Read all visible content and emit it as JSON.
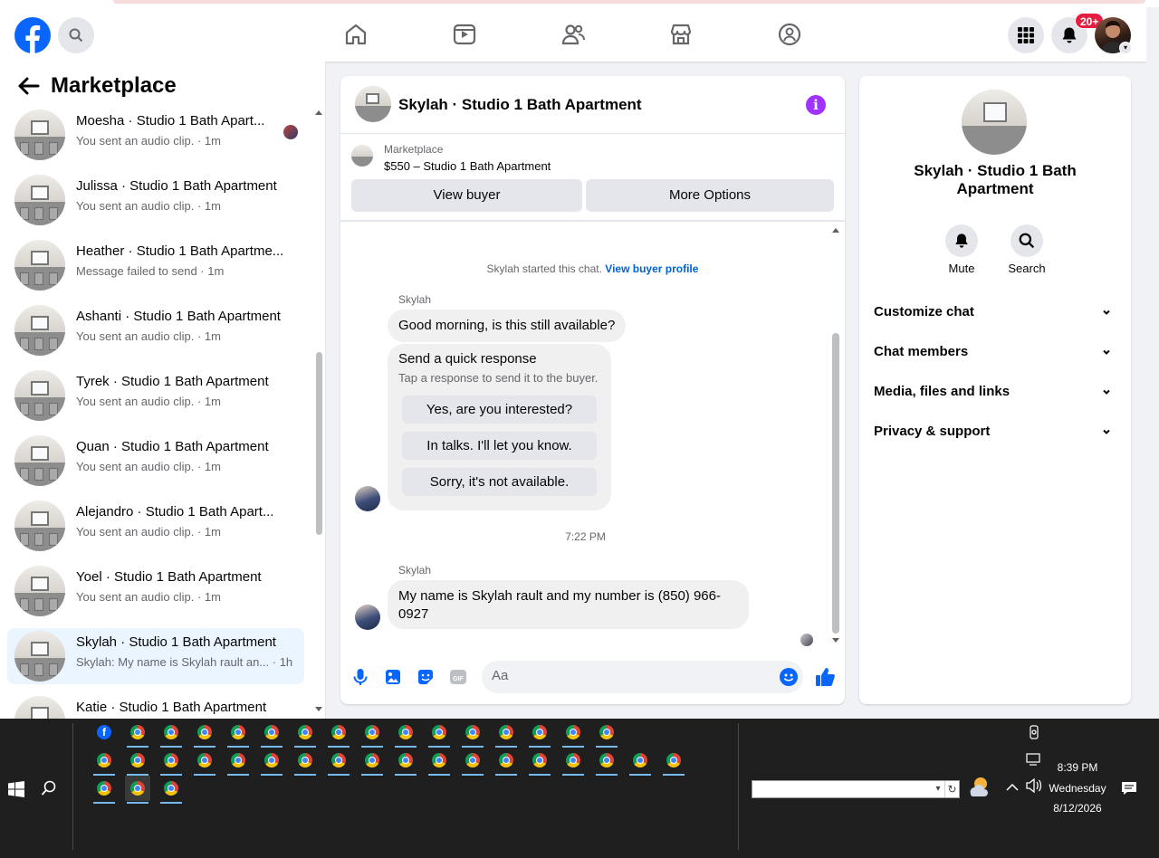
{
  "topnav": {
    "icons": [
      "facebook-logo",
      "search-icon",
      "home-icon",
      "video-icon",
      "friends-icon",
      "marketplace-icon",
      "groups-icon",
      "menu-grid-icon",
      "notifications-bell-icon"
    ],
    "notifications_badge": "20+"
  },
  "sidebar": {
    "title": "Marketplace",
    "conversations": [
      {
        "name": "Moesha · Studio 1 Bath Apart...",
        "sub": "You sent an audio clip. · 1m",
        "active": false
      },
      {
        "name": "Julissa · Studio 1 Bath Apartment",
        "sub": "You sent an audio clip. · 1m",
        "active": false
      },
      {
        "name": "Heather · Studio 1 Bath Apartme...",
        "sub": "Message failed to send · 1m",
        "active": false
      },
      {
        "name": "Ashanti · Studio 1 Bath Apartment",
        "sub": "You sent an audio clip. · 1m",
        "active": false
      },
      {
        "name": "Tyrek · Studio 1 Bath Apartment",
        "sub": "You sent an audio clip. · 1m",
        "active": false
      },
      {
        "name": "Quan · Studio 1 Bath Apartment",
        "sub": "You sent an audio clip. · 1m",
        "active": false
      },
      {
        "name": "Alejandro · Studio 1 Bath Apart...",
        "sub": "You sent an audio clip. · 1m",
        "active": false
      },
      {
        "name": "Yoel · Studio 1 Bath Apartment",
        "sub": "You sent an audio clip. · 1m",
        "active": false
      },
      {
        "name": "Skylah · Studio 1 Bath Apartment",
        "sub": "Skylah: My name is Skylah rault an... · 1h",
        "active": true
      },
      {
        "name": "Katie · Studio 1 Bath Apartment",
        "sub": "",
        "active": false
      }
    ]
  },
  "chat": {
    "title": "Skylah · Studio 1 Bath Apartment",
    "listing_label": "Marketplace",
    "listing_price": "$550 – Studio 1 Bath Apartment",
    "view_buyer": "View buyer",
    "more_options": "More Options",
    "started_text": "Skylah started this chat.",
    "view_profile": "View buyer profile",
    "sender": "Skylah",
    "msg1": "Good morning, is this still available?",
    "quick_title": "Send a quick response",
    "quick_sub": "Tap a response to send it to the buyer.",
    "quick_options": [
      "Yes, are you interested?",
      "In talks. I'll let you know.",
      "Sorry, it's not available."
    ],
    "timestamp": "7:22 PM",
    "msg2_line1": "My name is Skylah rault and my number is (850) 966-",
    "msg2_line2": "0927",
    "composer_placeholder": "Aa"
  },
  "details": {
    "name_line1": "Skylah · Studio 1 Bath",
    "name_line2": "Apartment",
    "mute": "Mute",
    "search": "Search",
    "sections": [
      "Customize chat",
      "Chat members",
      "Media, files and links",
      "Privacy & support"
    ]
  },
  "taskbar": {
    "time": "8:39 PM",
    "day": "Wednesday",
    "date": "8/12/2026"
  }
}
